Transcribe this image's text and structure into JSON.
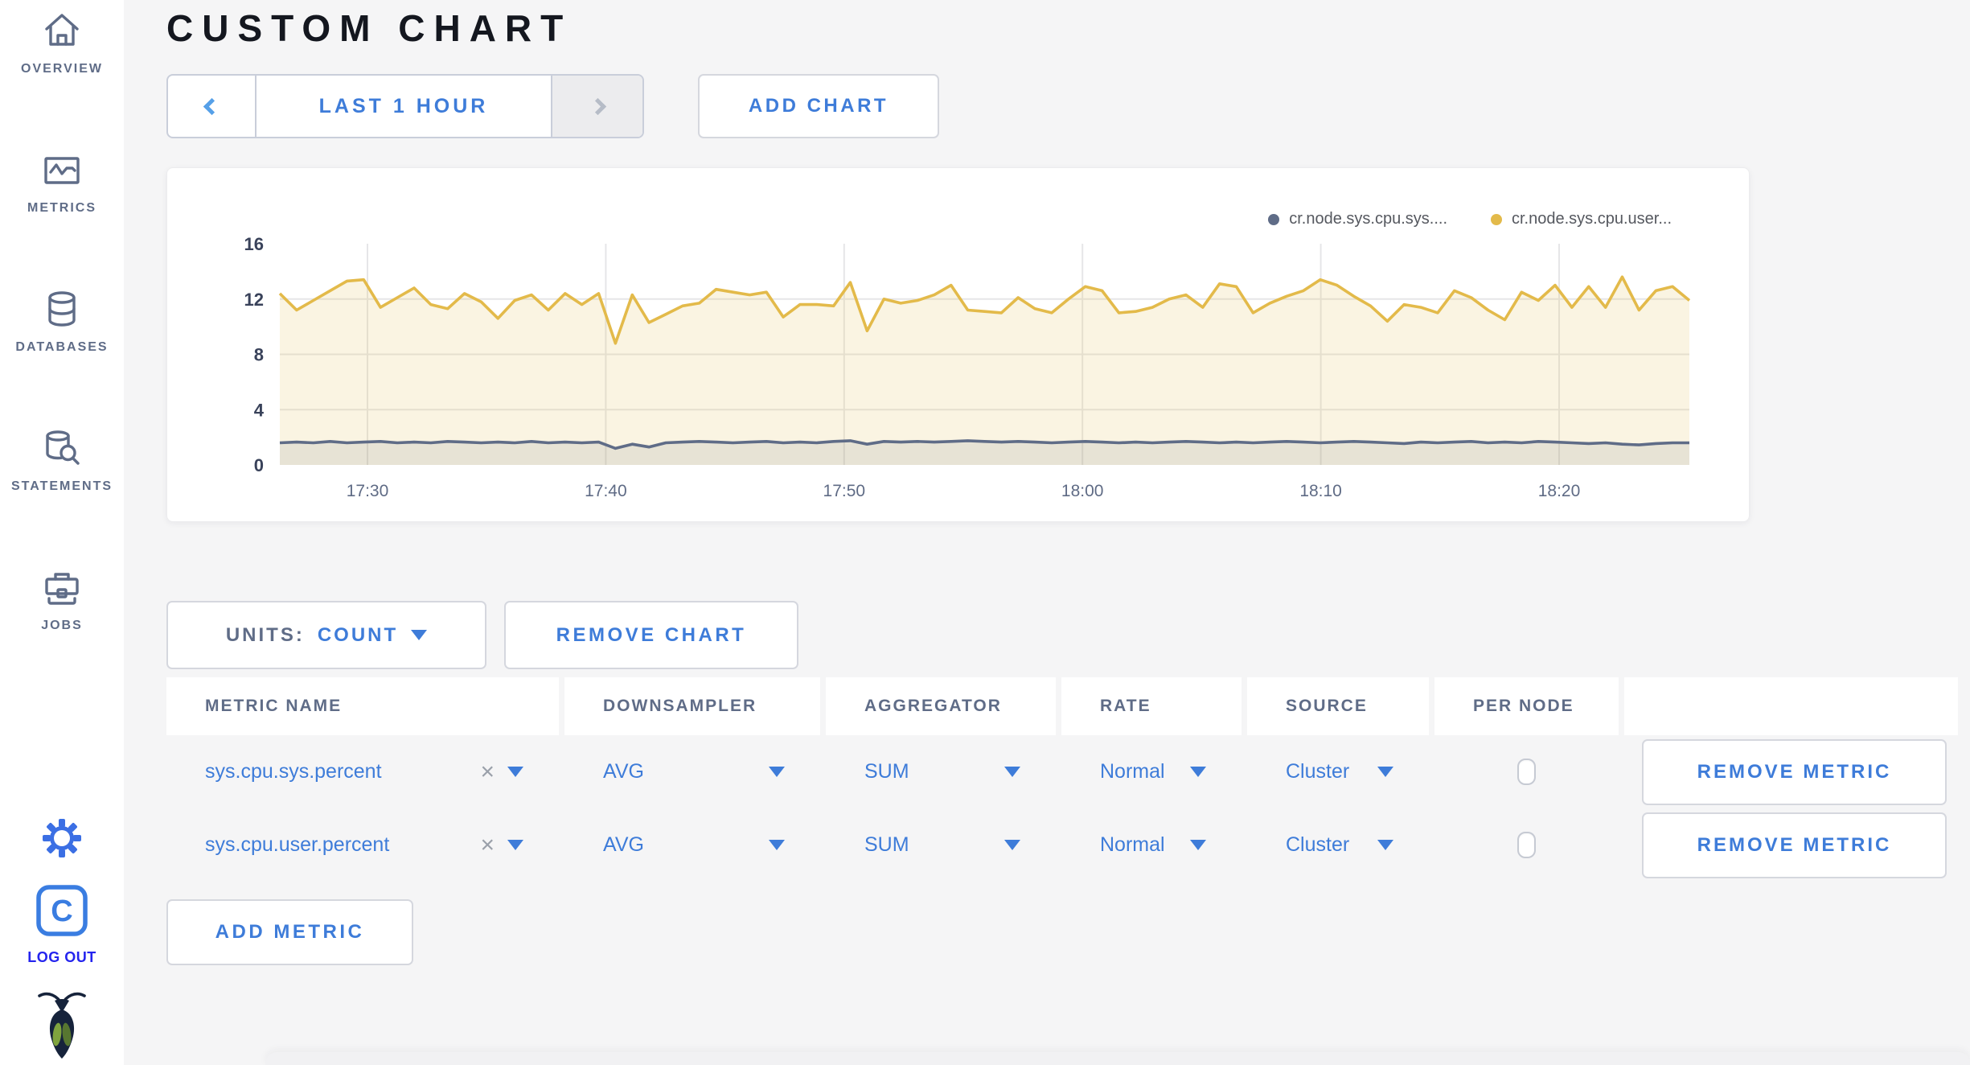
{
  "colors": {
    "accent_blue": "#3e7cd9",
    "logout_blue": "#2424ee",
    "slate": "#5f6c87",
    "series_sys": "#5f6c87",
    "series_user": "#e3ba4a",
    "disabled_bg": "#ececee",
    "grid_line": "#e6e6e8"
  },
  "sidebar": {
    "items": [
      {
        "icon": "home-icon",
        "label": "OVERVIEW"
      },
      {
        "icon": "metrics-icon",
        "label": "METRICS"
      },
      {
        "icon": "databases-icon",
        "label": "DATABASES"
      },
      {
        "icon": "statements-icon",
        "label": "STATEMENTS"
      },
      {
        "icon": "jobs-icon",
        "label": "JOBS"
      }
    ],
    "settings_icon": "gear-icon",
    "logout_label": "LOG OUT",
    "logo_icon": "cockroachdb-bug-logo"
  },
  "header": {
    "title": "CUSTOM CHART"
  },
  "toolbar": {
    "time_label": "LAST 1 HOUR",
    "prev_icon": "chevron-left-icon",
    "next_icon": "chevron-right-icon",
    "add_chart_label": "ADD CHART"
  },
  "chart_data": {
    "type": "line",
    "title": "",
    "xlabel": "",
    "ylabel": "",
    "ylim": [
      0,
      16
    ],
    "y_ticks": [
      0,
      4,
      8,
      12,
      16
    ],
    "grid_y_values": [
      4,
      8,
      12
    ],
    "x_ticks": [
      "17:30",
      "17:40",
      "17:50",
      "18:00",
      "18:10",
      "18:20"
    ],
    "x_range": [
      "17:26",
      "18:26"
    ],
    "grid": true,
    "legend_position": "top-right",
    "series": [
      {
        "name": "cr.node.sys.cpu.sys....",
        "color": "#5f6c87",
        "fill": "rgba(105,115,135,0.13)",
        "values": [
          1.6,
          1.65,
          1.6,
          1.7,
          1.6,
          1.65,
          1.7,
          1.6,
          1.65,
          1.6,
          1.7,
          1.65,
          1.6,
          1.65,
          1.6,
          1.7,
          1.6,
          1.65,
          1.6,
          1.65,
          1.2,
          1.5,
          1.3,
          1.6,
          1.65,
          1.7,
          1.65,
          1.6,
          1.65,
          1.7,
          1.6,
          1.65,
          1.6,
          1.7,
          1.75,
          1.5,
          1.7,
          1.65,
          1.7,
          1.65,
          1.7,
          1.75,
          1.7,
          1.65,
          1.7,
          1.65,
          1.6,
          1.65,
          1.7,
          1.65,
          1.6,
          1.65,
          1.6,
          1.65,
          1.7,
          1.65,
          1.6,
          1.65,
          1.6,
          1.65,
          1.7,
          1.65,
          1.6,
          1.65,
          1.7,
          1.65,
          1.6,
          1.55,
          1.65,
          1.6,
          1.65,
          1.7,
          1.6,
          1.65,
          1.6,
          1.7,
          1.65,
          1.6,
          1.55,
          1.6,
          1.5,
          1.45,
          1.55,
          1.6,
          1.6
        ]
      },
      {
        "name": "cr.node.sys.cpu.user...",
        "color": "#e3ba4a",
        "fill": "rgba(227,186,74,0.16)",
        "values": [
          12.4,
          11.2,
          11.9,
          12.6,
          13.3,
          13.4,
          11.4,
          12.1,
          12.8,
          11.6,
          11.3,
          12.4,
          11.8,
          10.6,
          11.9,
          12.3,
          11.2,
          12.4,
          11.6,
          12.4,
          8.8,
          12.3,
          10.3,
          10.9,
          11.5,
          11.7,
          12.7,
          12.5,
          12.3,
          12.5,
          10.7,
          11.6,
          11.6,
          11.5,
          13.2,
          9.7,
          12.0,
          11.7,
          11.9,
          12.3,
          13.0,
          11.2,
          11.1,
          11.0,
          12.1,
          11.3,
          11.0,
          12.0,
          12.9,
          12.6,
          11.0,
          11.1,
          11.4,
          12.0,
          12.3,
          11.4,
          13.1,
          12.9,
          11.0,
          11.7,
          12.2,
          12.6,
          13.4,
          13.0,
          12.2,
          11.5,
          10.4,
          11.6,
          11.4,
          11.0,
          12.6,
          12.1,
          11.2,
          10.5,
          12.5,
          11.9,
          13.0,
          11.4,
          12.9,
          11.4,
          13.6,
          11.2,
          12.6,
          12.9,
          11.9
        ]
      }
    ]
  },
  "chart_controls": {
    "units_label": "UNITS:",
    "units_value": "COUNT",
    "remove_chart_label": "REMOVE CHART"
  },
  "metrics_table": {
    "columns": [
      "METRIC NAME",
      "DOWNSAMPLER",
      "AGGREGATOR",
      "RATE",
      "SOURCE",
      "PER NODE",
      ""
    ],
    "rows": [
      {
        "metric_name": "sys.cpu.sys.percent",
        "downsampler": "AVG",
        "aggregator": "SUM",
        "rate": "Normal",
        "source": "Cluster",
        "per_node_checked": false,
        "remove_label": "REMOVE METRIC"
      },
      {
        "metric_name": "sys.cpu.user.percent",
        "downsampler": "AVG",
        "aggregator": "SUM",
        "rate": "Normal",
        "source": "Cluster",
        "per_node_checked": false,
        "remove_label": "REMOVE METRIC"
      }
    ],
    "add_metric_label": "ADD METRIC"
  }
}
